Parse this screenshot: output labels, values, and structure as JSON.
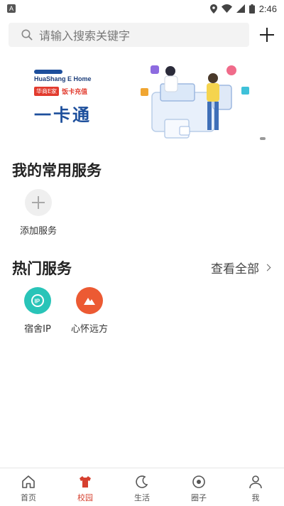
{
  "status_bar": {
    "time": "2:46",
    "left_badge": "A"
  },
  "search": {
    "placeholder": "请输入搜索关键字"
  },
  "banner": {
    "brand_en": "HuaShang E Home",
    "brand_tag": "华商E家",
    "brand_slogan": "饭卡充值",
    "title": "一卡通"
  },
  "my_services": {
    "title": "我的常用服务",
    "add_label": "添加服务"
  },
  "hot_services": {
    "title": "热门服务",
    "view_all": "查看全部",
    "items": [
      {
        "label": "宿舍IP",
        "color": "#29c4b8",
        "icon": "ip-icon"
      },
      {
        "label": "心怀远方",
        "color": "#ec5a33",
        "icon": "mountain-icon"
      }
    ]
  },
  "tabs": [
    {
      "label": "首页",
      "icon": "home-icon"
    },
    {
      "label": "校园",
      "icon": "shirt-icon",
      "active": true
    },
    {
      "label": "生活",
      "icon": "moon-icon"
    },
    {
      "label": "圈子",
      "icon": "circle-icon"
    },
    {
      "label": "我",
      "icon": "person-icon"
    }
  ],
  "colors": {
    "accent": "#d6402f",
    "brand_blue": "#1d4f9c"
  }
}
